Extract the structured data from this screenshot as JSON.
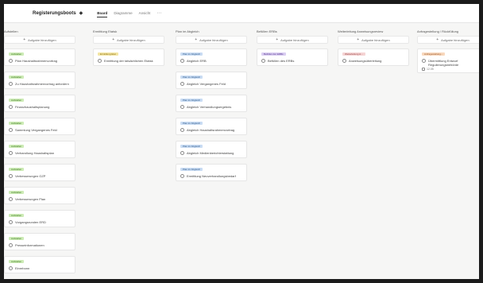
{
  "board": {
    "title": "Registerungsboots",
    "tabs": [
      "Board",
      "Diagramme",
      "Ansicht"
    ]
  },
  "columns": [
    {
      "name": "Aufstellen",
      "add_label": "Aufgabe hinzufügen",
      "cards": [
        {
          "badge": "Aufstellen",
          "badge_color": "green",
          "title": "Plan Haushaltsrahmenvortrag"
        },
        {
          "badge": "Aufstellen",
          "badge_color": "green",
          "title": "Zu Haushaltsrahmenvortrag anfordern"
        },
        {
          "badge": "Aufstellen",
          "badge_color": "green",
          "title": "Finanzhaushaltsplanung"
        },
        {
          "badge": "Aufstellen",
          "badge_color": "green",
          "title": "Sammlung Vergangenes Feld"
        },
        {
          "badge": "Aufstellen",
          "badge_color": "green",
          "title": "Verhandlung Haushaltsplan"
        },
        {
          "badge": "Aufstellen",
          "badge_color": "green",
          "title": "Verbesserungen GZP"
        },
        {
          "badge": "Aufstellen",
          "badge_color": "green",
          "title": "Verbesserungen Plan"
        },
        {
          "badge": "Aufstellen",
          "badge_color": "green",
          "title": "Vorgangsrunden ERD"
        },
        {
          "badge": "Aufstellen",
          "badge_color": "green",
          "title": "Presseinformationen"
        },
        {
          "badge": "Aufstellen",
          "badge_color": "green",
          "title": "Einrebonn"
        }
      ]
    },
    {
      "name": "Ermittlung Etatsk",
      "add_label": "Aufgabe hinzufügen",
      "cards": [
        {
          "badge": "Ermittlung Etat",
          "badge_color": "yellow",
          "title": "Ermittlung der tatsächlichen Etatsk"
        }
      ]
    },
    {
      "name": "Plan im Abgleich",
      "add_label": "Aufgabe hinzufügen",
      "cards": [
        {
          "badge": "Plan im Abgleich",
          "badge_color": "blue",
          "title": "Abgleich ERB"
        },
        {
          "badge": "Plan im Abgleich",
          "badge_color": "blue",
          "title": "Abgleich Vergangenes Feld"
        },
        {
          "badge": "Plan im Abgleich",
          "badge_color": "blue",
          "title": "Abgleich Verhandlungsergebnis"
        },
        {
          "badge": "Plan im Abgleich",
          "badge_color": "blue",
          "title": "Abgleich Haushaltsrahmenvortrag"
        },
        {
          "badge": "Plan im Abgleich",
          "badge_color": "blue",
          "title": "Abgleich Medienberichterstattung"
        },
        {
          "badge": "Plan im Abgleich",
          "badge_color": "blue",
          "title": "Ermittlung Neuverhandlungsbedarf"
        }
      ]
    },
    {
      "name": "Befüllen ERBs",
      "add_label": "Aufgabe hinzufügen",
      "cards": [
        {
          "badge": "Befüllen der ERBs",
          "badge_color": "purple",
          "title": "Befüllen des ERBs"
        }
      ]
    },
    {
      "name": "Weiterleitung Anweisungsreview",
      "add_label": "Aufgabe hinzufügen",
      "cards": [
        {
          "badge": "Weiterleitung A...",
          "badge_color": "pink",
          "title": "Anweisungsüberleitung"
        }
      ]
    },
    {
      "name": "Anfragestellung / Rückfüllung",
      "add_label": "Aufgabe hinzufügen",
      "cards": [
        {
          "badge": "Anfragestellung...",
          "badge_color": "orange",
          "title": "Übermittlung Entwurf Regulierungsbehörde",
          "date": "12.05"
        }
      ]
    }
  ]
}
